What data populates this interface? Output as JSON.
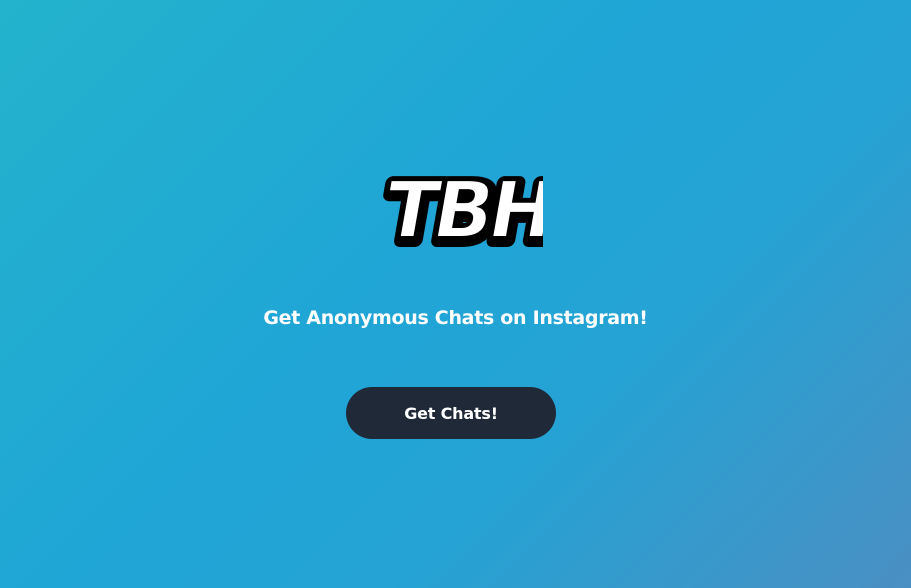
{
  "logo": {
    "text": "TBH",
    "fill_color": "#ffffff",
    "outline_color": "#000000"
  },
  "tagline": "Get Anonymous Chats on Instagram!",
  "cta": {
    "label": "Get Chats!",
    "background_color": "#1f2937",
    "text_color": "#ffffff"
  },
  "colors": {
    "background_gradient_start": "#23b3cc",
    "background_gradient_mid": "#20a5d6",
    "background_gradient_end": "#4a8fc3"
  }
}
